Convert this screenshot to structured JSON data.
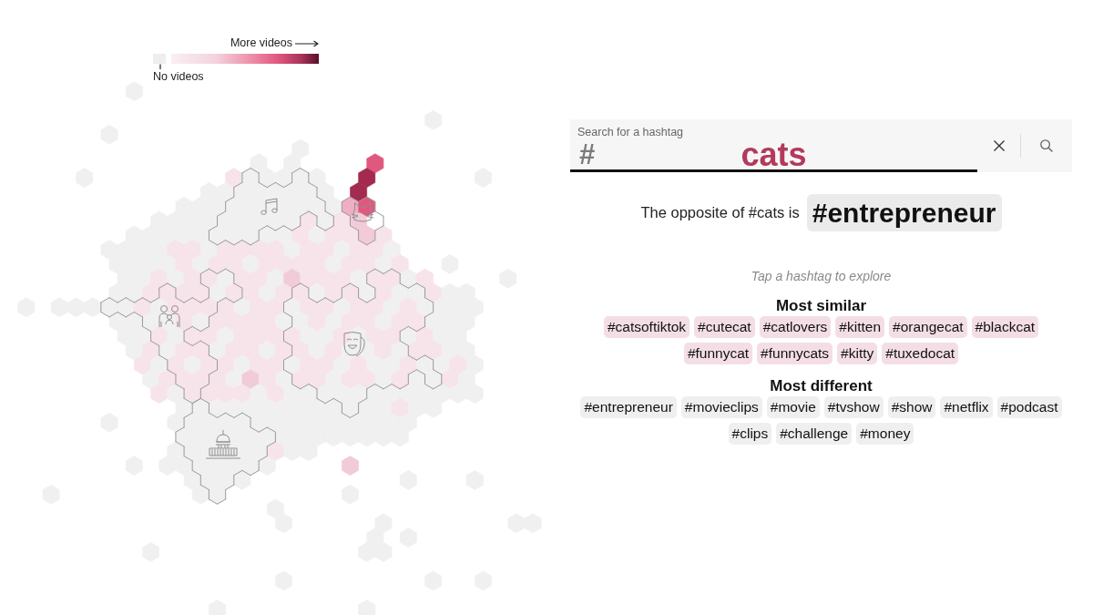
{
  "legend": {
    "more_label": "More videos",
    "none_label": "No videos"
  },
  "search": {
    "label": "Search for a hashtag",
    "prefix": "#",
    "value": "cats"
  },
  "opposite": {
    "text": "The opposite of #cats is",
    "hashtag": "#entrepreneur"
  },
  "hint": "Tap a hashtag to explore",
  "groups": [
    {
      "title": "Most similar",
      "kind": "similar",
      "tags": [
        "#catsoftiktok",
        "#cutecat",
        "#catlovers",
        "#kitten",
        "#orangecat",
        "#blackcat",
        "#funnycat",
        "#funnycats",
        "#kitty",
        "#tuxedocat"
      ]
    },
    {
      "title": "Most different",
      "kind": "different",
      "tags": [
        "#entrepreneur",
        "#movieclips",
        "#movie",
        "#tvshow",
        "#show",
        "#netflix",
        "#podcast",
        "#clips",
        "#challenge",
        "#money"
      ]
    }
  ]
}
